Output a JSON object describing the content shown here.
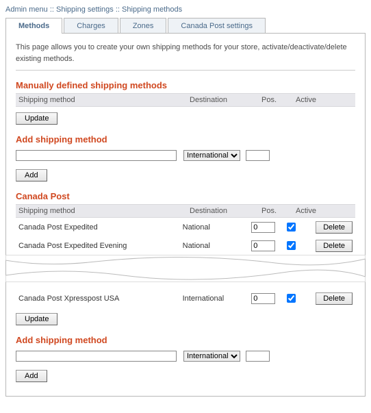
{
  "breadcrumb": {
    "admin_menu": "Admin menu",
    "sep": " ::",
    "shipping_settings": "Shipping settings",
    "shipping_methods": "Shipping methods"
  },
  "tabs": {
    "methods": "Methods",
    "charges": "Charges",
    "zones": "Zones",
    "canada_post": "Canada Post settings"
  },
  "intro": "This page allows you to create your own shipping methods for your store, activate/deactivate/delete existing methods.",
  "headers": {
    "method": "Shipping method",
    "destination": "Destination",
    "pos": "Pos.",
    "active": "Active"
  },
  "section1": {
    "title": "Manually defined shipping methods",
    "update": "Update",
    "add_title": "Add shipping method",
    "add_button": "Add",
    "new_name": "",
    "new_pos": "",
    "dest_options": [
      "International"
    ]
  },
  "section2": {
    "title": "Canada Post",
    "rows": [
      {
        "method": "Canada Post Expedited",
        "destination": "National",
        "pos": "0",
        "active": true
      },
      {
        "method": "Canada Post Expedited Evening",
        "destination": "National",
        "pos": "0",
        "active": true
      },
      {
        "method": "Canada Post Xpresspost USA",
        "destination": "International",
        "pos": "0",
        "active": true
      }
    ],
    "delete": "Delete",
    "update": "Update",
    "add_title": "Add shipping method",
    "add_button": "Add",
    "new_name": "",
    "new_pos": "",
    "dest_options": [
      "International"
    ]
  }
}
